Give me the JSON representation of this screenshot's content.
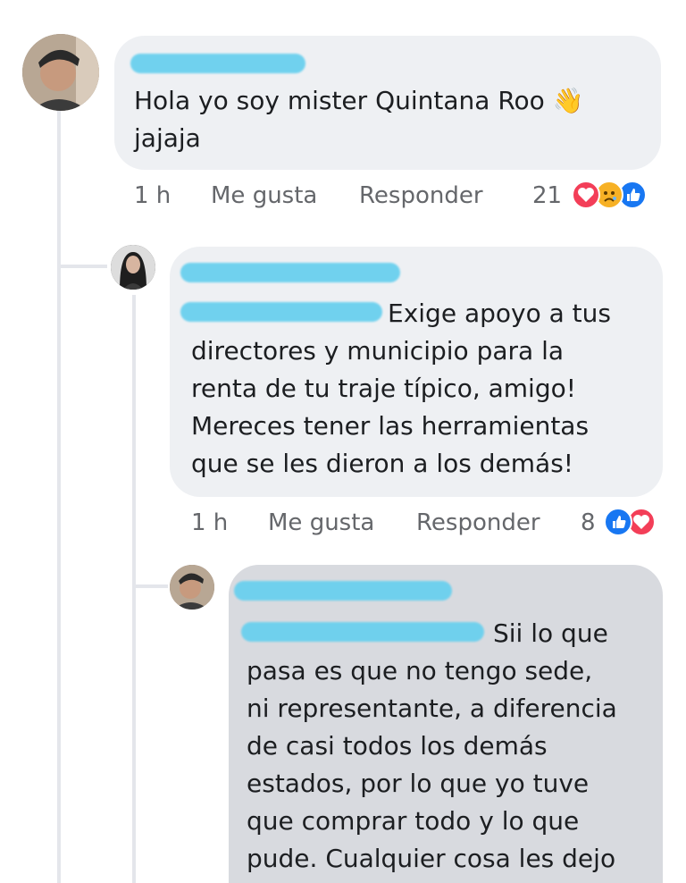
{
  "comments": [
    {
      "text_line1": "Hola yo soy mister Quintana Roo",
      "text_line2": "jajaja",
      "wave_emoji": "👋",
      "time": "1 h",
      "like_label": "Me gusta",
      "reply_label": "Responder",
      "reaction_count": "21",
      "reactions": [
        "love-icon",
        "sad-icon",
        "like-icon"
      ]
    },
    {
      "lines": [
        "Exige apoyo a tus",
        "directores y municipio para la",
        "renta de tu traje típico, amigo!",
        "Mereces tener las herramientas",
        "que se les dieron a los demás!"
      ],
      "time": "1 h",
      "like_label": "Me gusta",
      "reply_label": "Responder",
      "reaction_count": "8",
      "reactions": [
        "like-icon",
        "love-icon"
      ]
    },
    {
      "lines": [
        "Sii lo que",
        "pasa es que no tengo sede,",
        "ni representante, a diferencia",
        "de casi todos los demás",
        "estados, por lo que yo tuve",
        "que comprar todo y lo que",
        "pude. Cualquier cosa les dejo"
      ]
    }
  ],
  "colors": {
    "bubble": "#eef0f3",
    "bubble_dark": "#d8dadf",
    "like": "#1877f2",
    "love": "#f33e58",
    "sad": "#f7b125",
    "redaction": "#6ad0ee"
  }
}
